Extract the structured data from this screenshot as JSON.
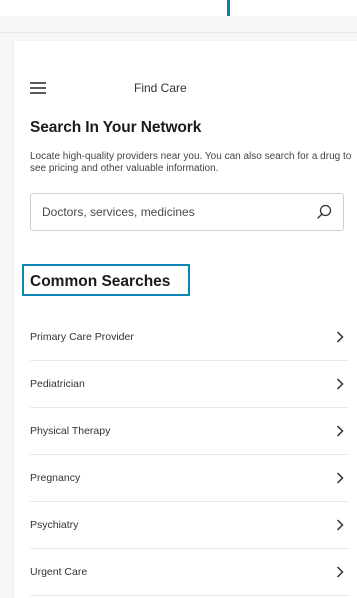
{
  "appbar": {
    "title": "Find Care",
    "menu_icon": "hamburger-menu-icon"
  },
  "search_section": {
    "heading": "Search In Your Network",
    "description": "Locate high-quality providers near you. You can also search for a drug to see pricing and other valuable information.",
    "search": {
      "placeholder": "Doctors, services, medicines",
      "value": "",
      "icon": "search-icon"
    }
  },
  "common_searches": {
    "heading": "Common Searches",
    "items": [
      {
        "label": "Primary Care Provider",
        "icon": "chevron-right-icon"
      },
      {
        "label": "Pediatrician",
        "icon": "chevron-right-icon"
      },
      {
        "label": "Physical Therapy",
        "icon": "chevron-right-icon"
      },
      {
        "label": "Pregnancy",
        "icon": "chevron-right-icon"
      },
      {
        "label": "Psychiatry",
        "icon": "chevron-right-icon"
      },
      {
        "label": "Urgent Care",
        "icon": "chevron-right-icon"
      }
    ]
  },
  "colors": {
    "highlight": "#0a86b8",
    "text": "#1b1b1b",
    "divider": "#e8e8e8"
  }
}
